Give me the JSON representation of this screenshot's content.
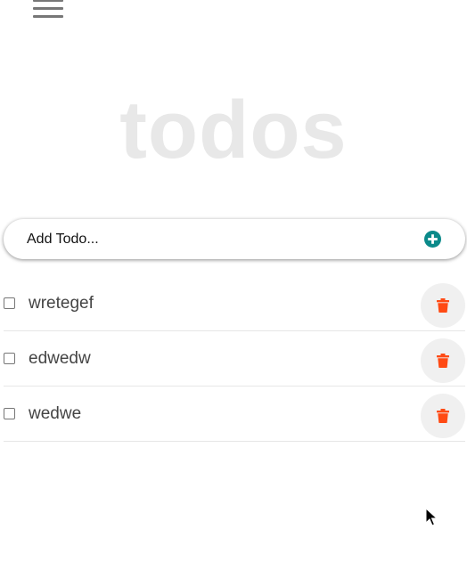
{
  "header": {
    "menu_icon": "hamburger-menu-icon",
    "title": "todos"
  },
  "add_todo": {
    "placeholder": "Add Todo...",
    "button_icon": "plus-circle-icon",
    "button_color": "#0b8a8a"
  },
  "todos": [
    {
      "text": "wretegef",
      "completed": false
    },
    {
      "text": "edwedw",
      "completed": false
    },
    {
      "text": "wedwe",
      "completed": false
    }
  ],
  "delete": {
    "icon": "trash-icon",
    "color": "#ff4a14"
  }
}
